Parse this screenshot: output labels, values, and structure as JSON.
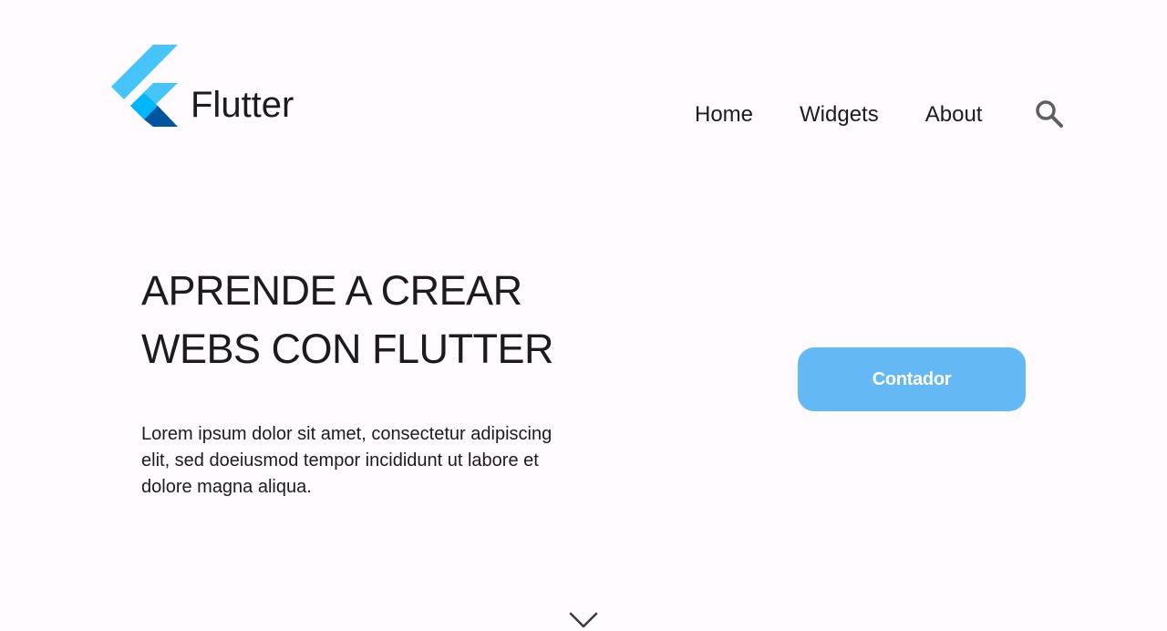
{
  "header": {
    "brand": "Flutter",
    "nav": {
      "home": "Home",
      "widgets": "Widgets",
      "about": "About"
    },
    "search_icon": "search-icon"
  },
  "hero": {
    "headline_line1": "APRENDE A CREAR",
    "headline_line2": "WEBS CON FLUTTER",
    "description": "Lorem ipsum dolor sit amet, consectetur adipiscing elit, sed doeiusmod tempor incididunt ut labore et dolore magna aliqua.",
    "button_label": "Contador"
  },
  "footer": {
    "scroll_icon": "chevron-down-icon"
  },
  "colors": {
    "background": "#fffbfe",
    "button": "#64b8f4",
    "logo_light": "#47c5fb",
    "logo_mid": "#00b5f8",
    "logo_dark": "#00569e"
  }
}
